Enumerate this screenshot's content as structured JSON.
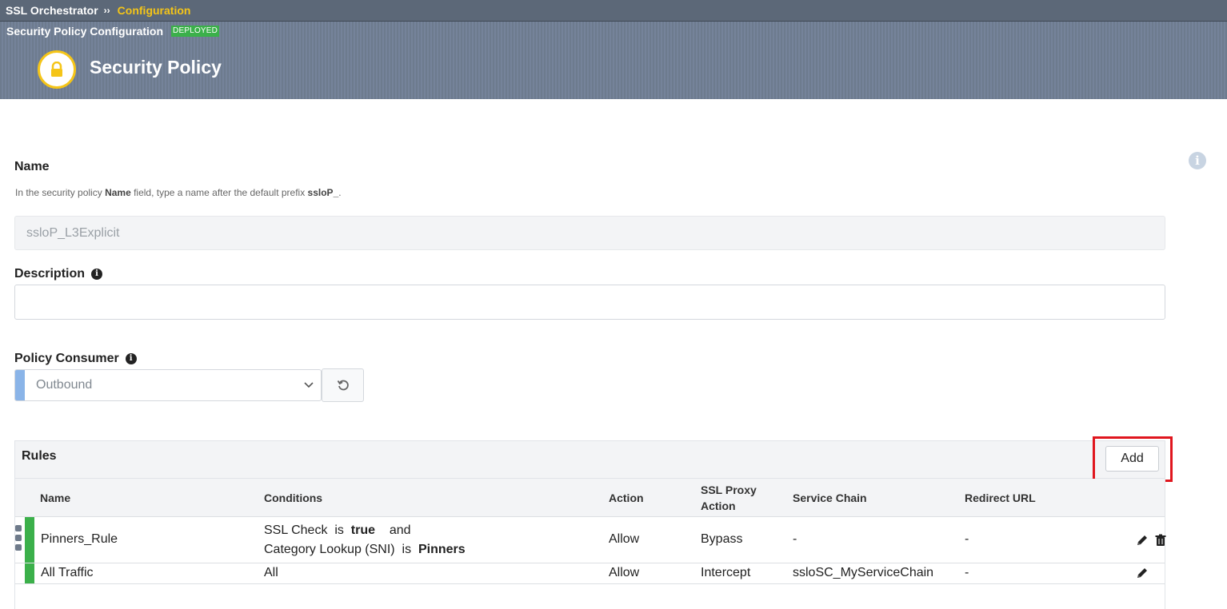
{
  "breadcrumb": {
    "app": "SSL Orchestrator",
    "separator": "››",
    "current": "Configuration"
  },
  "header": {
    "subtitle": "Security Policy Configuration",
    "status_badge": "DEPLOYED",
    "title": "Security Policy"
  },
  "form": {
    "name": {
      "label": "Name",
      "help_prefix": "In the security policy ",
      "help_bold1": "Name",
      "help_middle": " field, type a name after the default prefix ",
      "help_bold2": "ssloP_",
      "help_suffix": ".",
      "value": "ssloP_L3Explicit"
    },
    "description": {
      "label": "Description",
      "value": ""
    },
    "policy_consumer": {
      "label": "Policy Consumer",
      "value": "Outbound"
    }
  },
  "rules": {
    "title": "Rules",
    "add_label": "Add",
    "columns": {
      "name": "Name",
      "conditions": "Conditions",
      "action": "Action",
      "ssl_proxy_action_1": "SSL Proxy",
      "ssl_proxy_action_2": "Action",
      "service_chain": "Service Chain",
      "redirect_url": "Redirect URL"
    },
    "rows": [
      {
        "name": "Pinners_Rule",
        "cond1_a": "SSL Check",
        "cond1_is": "is",
        "cond1_b": "true",
        "cond_and": "and",
        "cond2_a": "Category Lookup (SNI)",
        "cond2_is": "is",
        "cond2_b": "Pinners",
        "action": "Allow",
        "ssl_proxy_action": "Bypass",
        "service_chain": "-",
        "redirect_url": "-"
      },
      {
        "name": "All Traffic",
        "conditions": "All",
        "action": "Allow",
        "ssl_proxy_action": "Intercept",
        "service_chain": "ssloSC_MyServiceChain",
        "redirect_url": "-"
      }
    ]
  },
  "colors": {
    "accent_yellow": "#f5c518",
    "status_green": "#3bb04a",
    "highlight_red": "#e0161e"
  }
}
